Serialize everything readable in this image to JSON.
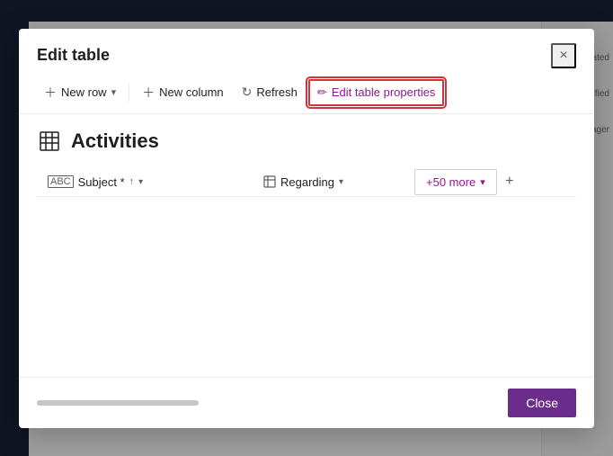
{
  "modal": {
    "title": "Edit table",
    "close_label": "×"
  },
  "toolbar": {
    "new_row_label": "New row",
    "new_row_dropdown_icon": "▾",
    "new_column_label": "New column",
    "refresh_label": "Refresh",
    "edit_table_properties_label": "Edit table properties"
  },
  "table": {
    "name": "Activities",
    "columns": [
      {
        "label": "Subject *",
        "icon": "abc-icon",
        "sort": "↑",
        "dropdown": "▾"
      },
      {
        "label": "Regarding",
        "icon": "grid-icon",
        "dropdown": "▾"
      }
    ],
    "more_btn_label": "+50 more",
    "more_btn_dropdown": "▾",
    "add_col_label": "+"
  },
  "footer": {
    "close_button_label": "Close"
  },
  "background": {
    "strip_labels": [
      "Created",
      "Modified",
      "Manager"
    ]
  }
}
